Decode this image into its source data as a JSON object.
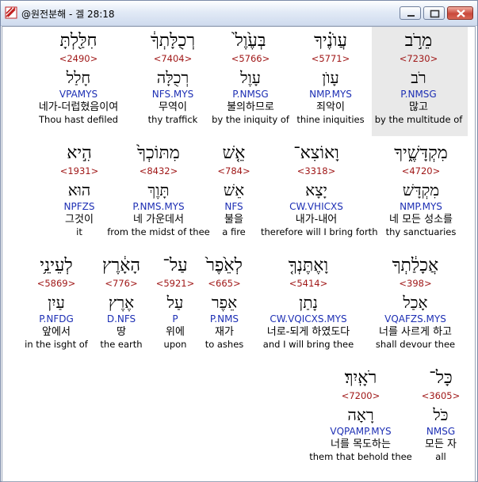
{
  "window": {
    "title": "@원전분해 - 겔 28:18"
  },
  "rows": [
    [
      {
        "heb": "חִלַּ֖לְתָּ",
        "num": "<2490>",
        "lex": "חָלַל",
        "code": "VPAMYS",
        "kor": "네가-더럽혔음이여",
        "eng": "Thou hast defiled"
      },
      {
        "heb": "רְכֻלָּתְךָ֔",
        "num": "<7404>",
        "lex": "רְכֻלָּה",
        "code": "NFS.MYS",
        "kor": "무역이",
        "eng": "thy traffick"
      },
      {
        "heb": "בְּעֶ֙וֶל֙",
        "num": "<5766>",
        "lex": "עָוֶל",
        "code": "P.NMSG",
        "kor": "불의하므로",
        "eng": "by the iniquity of"
      },
      {
        "heb": "עֲוֺנֶ֗יךָ",
        "num": "<5771>",
        "lex": "עָוֺן",
        "code": "NMP.MYS",
        "kor": "죄악이",
        "eng": "thine iniquities"
      },
      {
        "heb": "מֵרֹ֣ב",
        "num": "<7230>",
        "lex": "רֹב",
        "code": "P.NMSG",
        "kor": "많고",
        "eng": "by the multitude of"
      }
    ],
    [
      {
        "heb": "הִ֣יא",
        "num": "<1931>",
        "lex": "הוּא",
        "code": "NPFZS",
        "kor": "그것이",
        "eng": "it"
      },
      {
        "heb": "מִתּוֹכְךָ֙",
        "num": "<8432>",
        "lex": "תָּוֶךְ",
        "code": "P.NMS.MYS",
        "kor": "네 가운데서",
        "eng": "from the midst of thee"
      },
      {
        "heb": "אֵ֤שׁ",
        "num": "<784>",
        "lex": "אֵשׁ",
        "code": "NFS",
        "kor": "불을",
        "eng": "a fire"
      },
      {
        "heb": "וָאוֹצִא־",
        "num": "<3318>",
        "lex": "יָצָא",
        "code": "CW.VHICXS",
        "kor": "내가-내어",
        "eng": "therefore will I bring forth"
      },
      {
        "heb": "מִקְדָּשֶׁ֑יךָ",
        "num": "<4720>",
        "lex": "מִקְדָּשׁ",
        "code": "NMP.MYS",
        "kor": "네 모든 성소를",
        "eng": "thy sanctuaries"
      }
    ],
    [
      {
        "heb": "לְעֵינֵ֥י",
        "num": "<5869>",
        "lex": "עַיִן",
        "code": "P.NFDG",
        "kor": "앞에서",
        "eng": "in the isght of"
      },
      {
        "heb": "הָאָ֔רֶץ",
        "num": "<776>",
        "lex": "אֶרֶץ",
        "code": "D.NFS",
        "kor": "땅",
        "eng": "the earth"
      },
      {
        "heb": "עַל־",
        "num": "<5921>",
        "lex": "עַל",
        "code": "P",
        "kor": "위에",
        "eng": "upon"
      },
      {
        "heb": "לְאֵ֙פֶר֙",
        "num": "<665>",
        "lex": "אֵפֶר",
        "code": "P.NMS",
        "kor": "재가",
        "eng": "to ashes"
      },
      {
        "heb": "וָאֶתֶּנְךָ֤",
        "num": "<5414>",
        "lex": "נָתַן",
        "code": "CW.VQICXS.MYS",
        "kor": "너로-되게 하였도다",
        "eng": "and I will bring thee"
      },
      {
        "heb": "אֲכָלַ֔תְךָ",
        "num": "<398>",
        "lex": "אָכַל",
        "code": "VQAFZS.MYS",
        "kor": "너를 사르게 하고",
        "eng": "shall devour thee"
      }
    ],
    [
      {
        "heb": "רֹאָֽיִךְ׃",
        "num": "<7200>",
        "lex": "רָאָה",
        "code": "VQPAMP.MYS",
        "kor": "너를 목도하는",
        "eng": "them that behold thee"
      },
      {
        "heb": "כָּל־",
        "num": "<3605>",
        "lex": "כֹּל",
        "code": "NMSG",
        "kor": "모든 자",
        "eng": "all"
      }
    ]
  ]
}
